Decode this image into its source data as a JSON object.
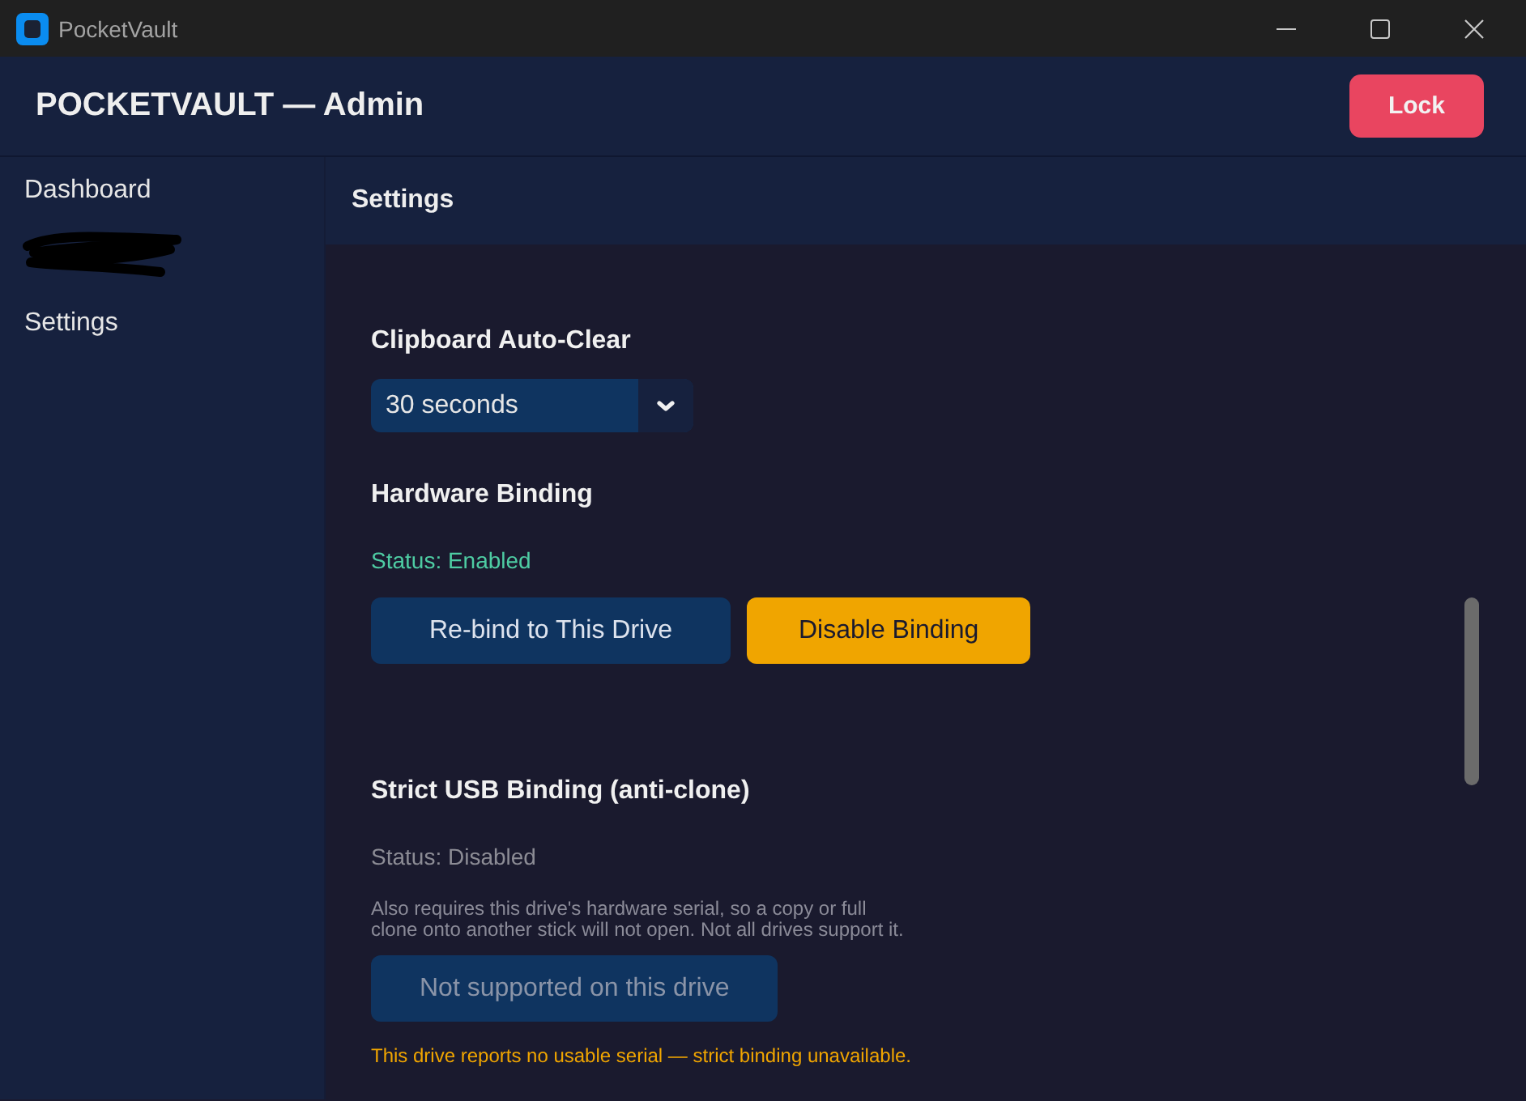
{
  "window": {
    "title": "PocketVault"
  },
  "header": {
    "title": "POCKETVAULT — Admin",
    "lock_button": "Lock"
  },
  "sidebar": {
    "items": [
      {
        "kind": "link",
        "label": "Dashboard"
      },
      {
        "kind": "redacted"
      },
      {
        "kind": "link",
        "label": "Settings"
      }
    ]
  },
  "page": {
    "title": "Settings",
    "sections": [
      {
        "kind": "select",
        "title": "Clipboard Auto-Clear",
        "value": "30 seconds"
      },
      {
        "kind": "binding",
        "title": "Hardware Binding",
        "status": "Status: Enabled",
        "enabled": true,
        "buttons": [
          {
            "label": "Re-bind to This Drive",
            "kind": "primary",
            "disabled": false
          },
          {
            "label": "Disable Binding",
            "kind": "warning",
            "disabled": false
          }
        ]
      },
      {
        "kind": "binding",
        "title": "Strict USB Binding (anti-clone)",
        "status": "Status: Disabled",
        "enabled": false,
        "description": "Also requires this drive's hardware serial, so a copy or full clone onto another stick will not open. Not all drives support it.",
        "buttons": [
          {
            "label": "Not supported on this drive",
            "kind": "primary",
            "disabled": true
          }
        ],
        "warning": "This drive reports no usable serial — strict binding unavailable."
      }
    ]
  }
}
